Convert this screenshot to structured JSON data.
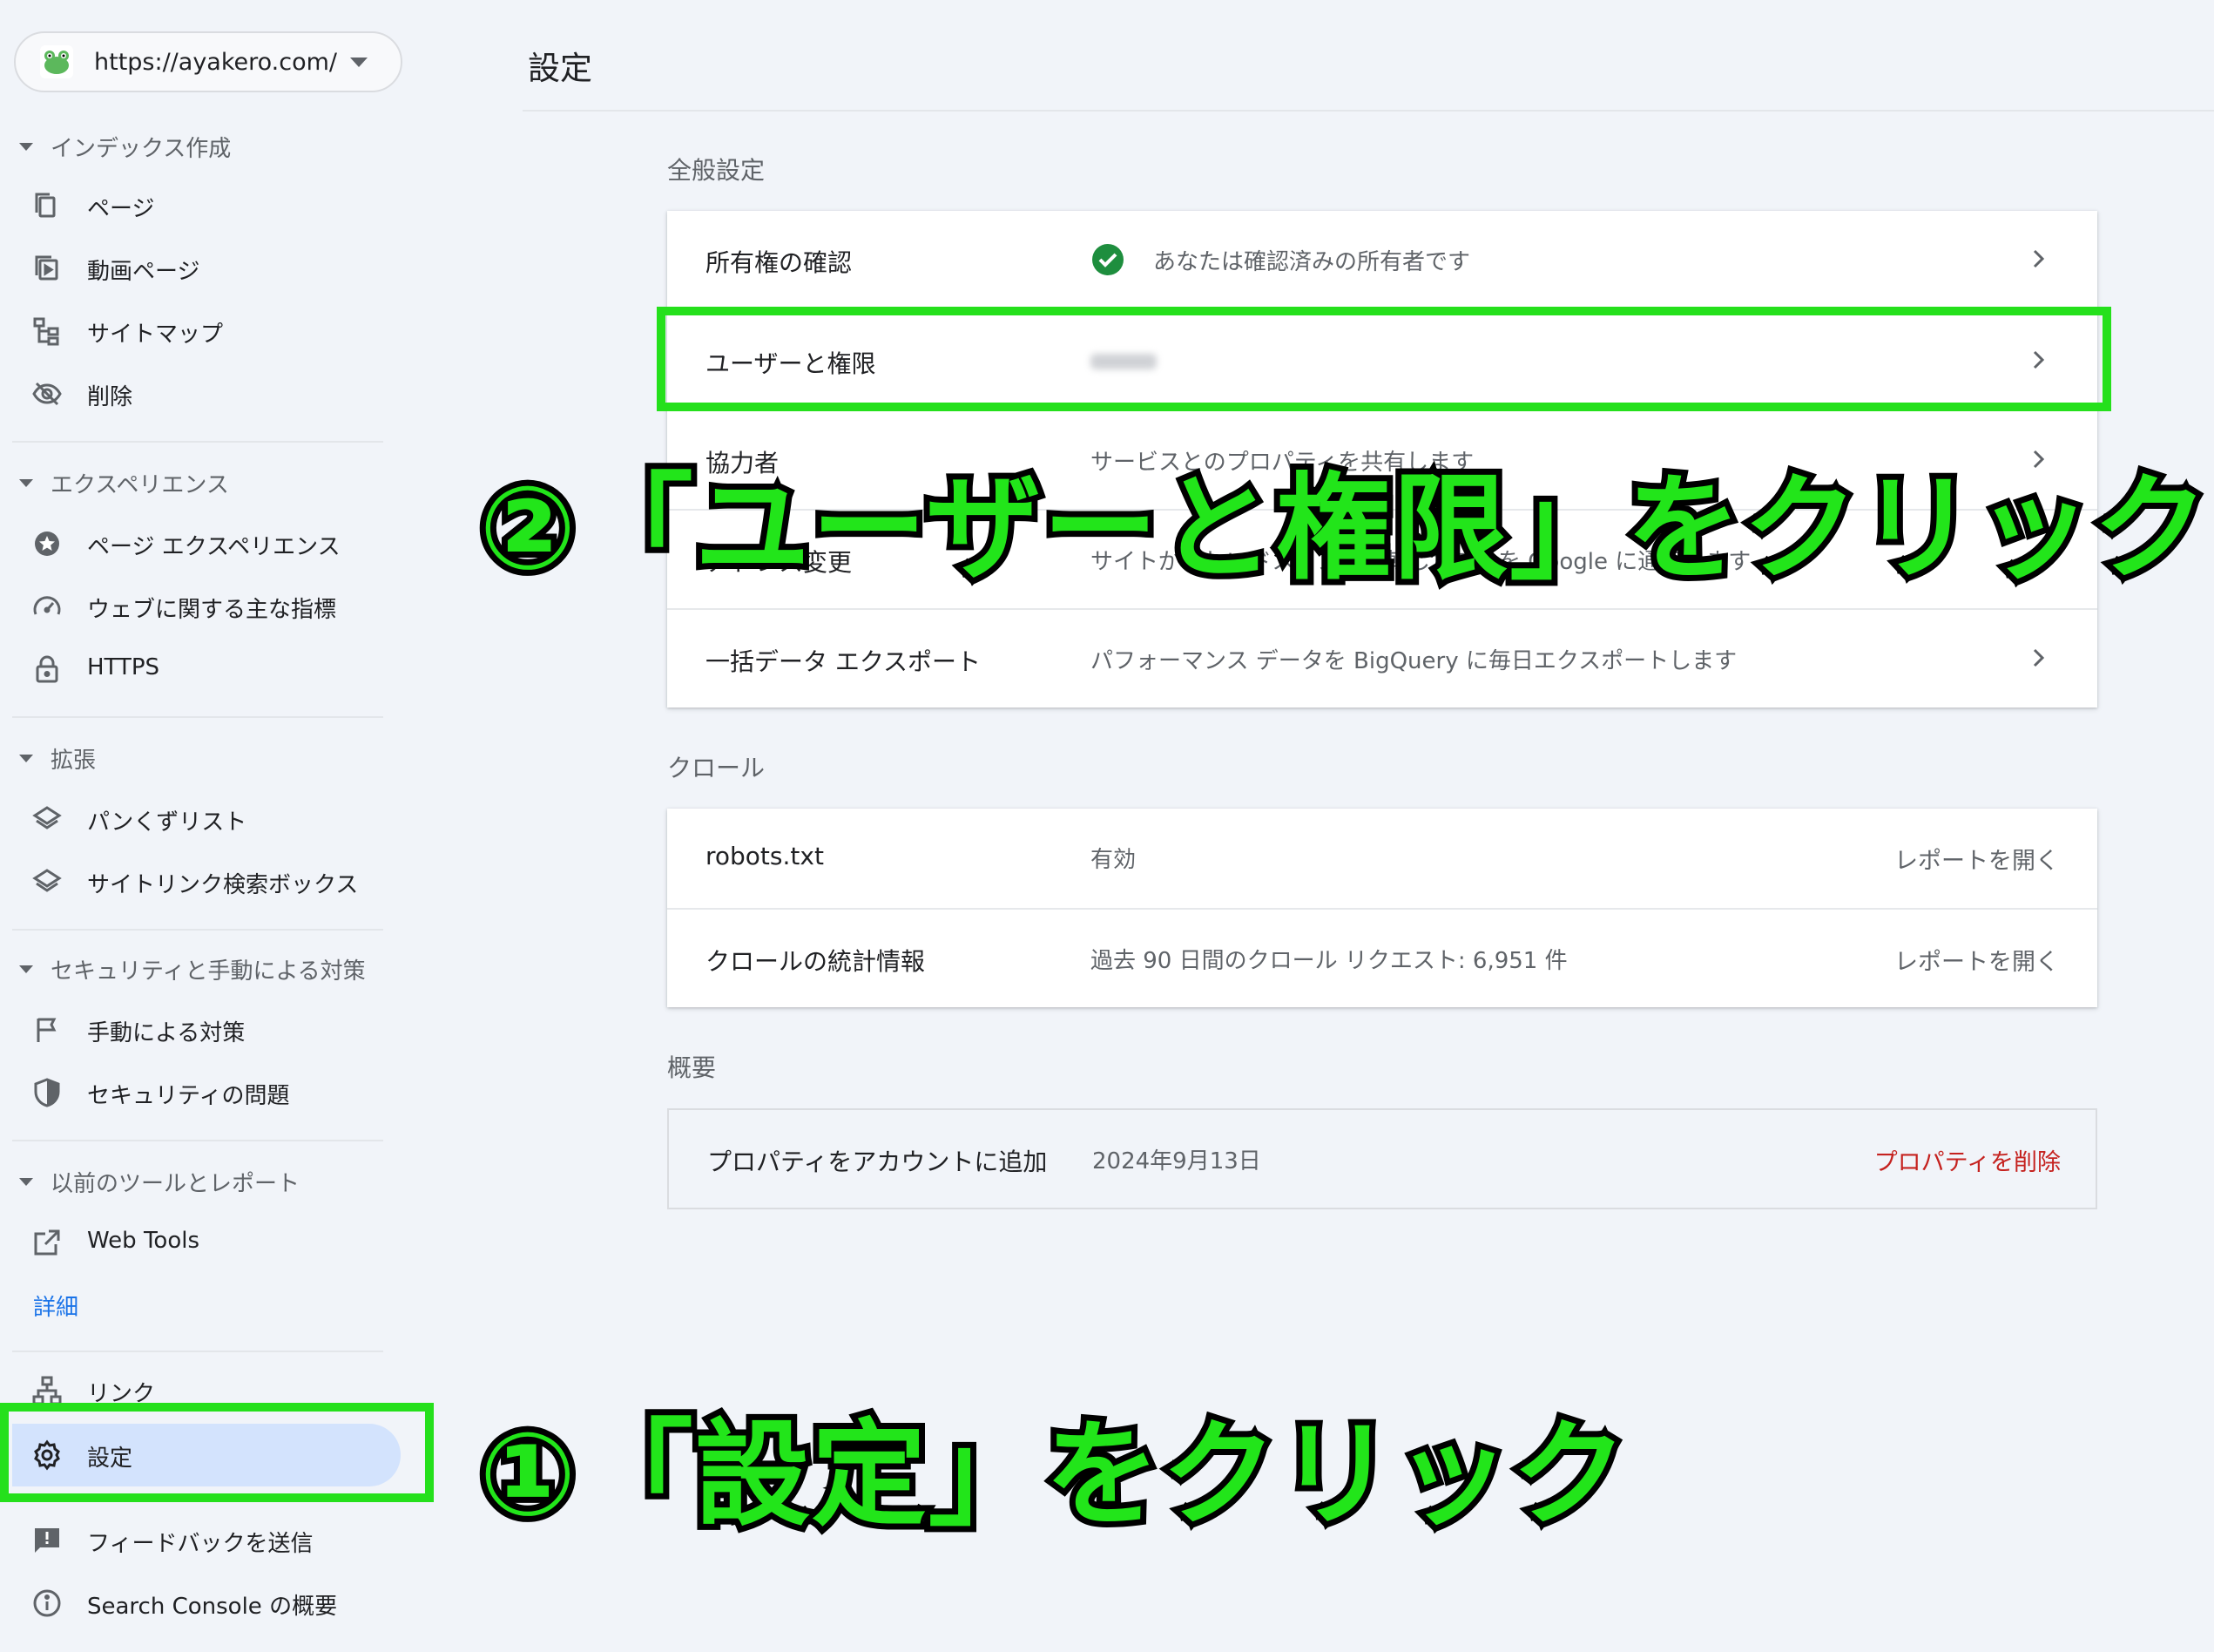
{
  "property": {
    "url": "https://ayakero.com/"
  },
  "sidebar": {
    "sections": [
      {
        "title": "インデックス作成",
        "items": [
          {
            "label": "ページ",
            "icon": "pages-icon"
          },
          {
            "label": "動画ページ",
            "icon": "video-pages-icon"
          },
          {
            "label": "サイトマップ",
            "icon": "sitemap-icon"
          },
          {
            "label": "削除",
            "icon": "removals-icon"
          }
        ]
      },
      {
        "title": "エクスペリエンス",
        "items": [
          {
            "label": "ページ エクスペリエンス",
            "icon": "page-experience-icon"
          },
          {
            "label": "ウェブに関する主な指標",
            "icon": "speedometer-icon"
          },
          {
            "label": "HTTPS",
            "icon": "lock-icon"
          }
        ]
      },
      {
        "title": "拡張",
        "items": [
          {
            "label": "パンくずリスト",
            "icon": "layers-icon"
          },
          {
            "label": "サイトリンク検索ボックス",
            "icon": "layers-icon"
          }
        ]
      },
      {
        "title": "セキュリティと手動による対策",
        "items": [
          {
            "label": "手動による対策",
            "icon": "flag-icon"
          },
          {
            "label": "セキュリティの問題",
            "icon": "shield-icon"
          }
        ]
      },
      {
        "title": "以前のツールとレポート",
        "items": [
          {
            "label": "Web Tools",
            "icon": "external-link-icon"
          }
        ]
      }
    ],
    "detail_link": "詳細",
    "bottom_items": [
      {
        "label": "リンク",
        "icon": "links-icon"
      },
      {
        "label": "設定",
        "icon": "gear-icon",
        "active": true
      },
      {
        "label": "フィードバックを送信",
        "icon": "feedback-icon"
      },
      {
        "label": "Search Console の概要",
        "icon": "info-icon"
      }
    ]
  },
  "main": {
    "title": "設定",
    "general": {
      "heading": "全般設定",
      "rows": [
        {
          "label": "所有権の確認",
          "value": "あなたは確認済みの所有者です"
        },
        {
          "label": "ユーザーと権限",
          "value": ""
        },
        {
          "label": "協力者",
          "value": "サービスとのプロパティを共有します"
        },
        {
          "label": "アドレス変更",
          "value": "サイトが新しいドメインに移転したことを Google に通知します"
        },
        {
          "label": "一括データ エクスポート",
          "value": "パフォーマンス データを BigQuery に毎日エクスポートします"
        }
      ]
    },
    "crawl": {
      "heading": "クロール",
      "rows": [
        {
          "label": "robots.txt",
          "value": "有効",
          "action": "レポートを開く"
        },
        {
          "label": "クロールの統計情報",
          "value": "過去 90 日間のクロール リクエスト: 6,951 件",
          "action": "レポートを開く"
        }
      ]
    },
    "about": {
      "heading": "概要",
      "rows": [
        {
          "label": "プロパティをアカウントに追加",
          "value": "2024年9月13日",
          "action": "プロパティを削除"
        }
      ]
    }
  },
  "annotations": {
    "step1": "①「設定」をクリック",
    "step2": "②「ユーザーと権限」をクリック",
    "color": "#25e01c"
  }
}
